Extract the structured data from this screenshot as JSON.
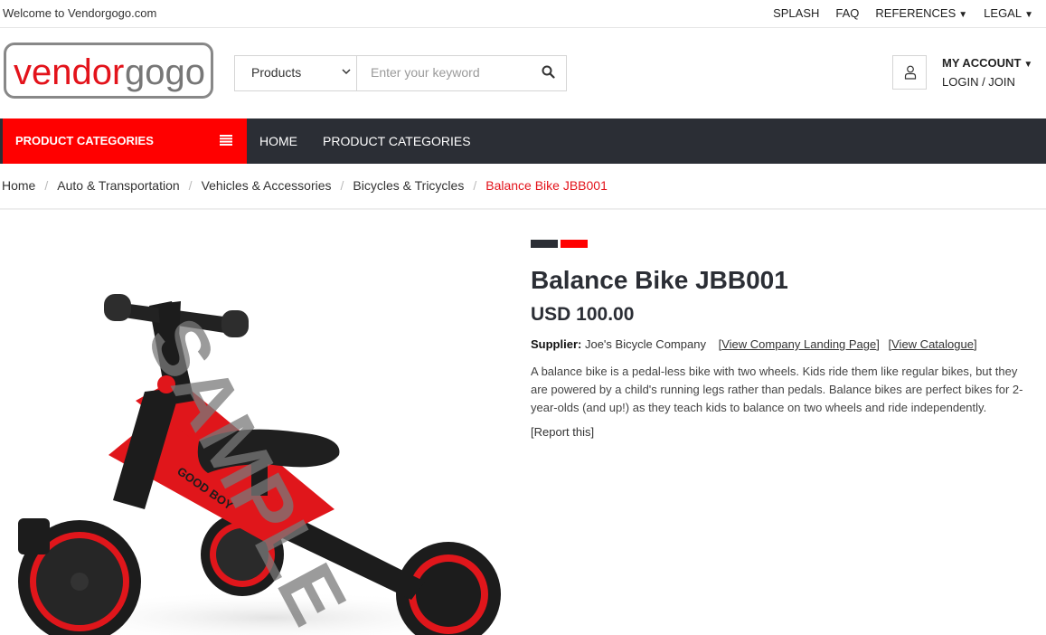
{
  "topbar": {
    "welcome": "Welcome to Vendorgogo.com",
    "links": [
      "SPLASH",
      "FAQ",
      "REFERENCES",
      "LEGAL"
    ]
  },
  "logo": {
    "part1": "vendor",
    "part2": "gogo"
  },
  "search": {
    "category": "Products",
    "placeholder": "Enter your keyword",
    "value": ""
  },
  "account": {
    "title": "MY ACCOUNT",
    "login": "LOGIN / JOIN"
  },
  "nav": {
    "categories_label": "PRODUCT CATEGORIES",
    "links": [
      "HOME",
      "PRODUCT CATEGORIES"
    ]
  },
  "breadcrumb": [
    "Home",
    "Auto & Transportation",
    "Vehicles & Accessories",
    "Bicycles & Tricycles",
    "Balance Bike JBB001"
  ],
  "product": {
    "image_watermark": "SAMPLE",
    "image_print": "GOOD BOY",
    "title": "Balance Bike JBB001",
    "price": "USD 100.00",
    "supplier_label": "Supplier:",
    "supplier_name": "Joe's Bicycle Company",
    "link_landing": "View Company Landing Page",
    "link_catalogue": "View Catalogue",
    "description": "A balance bike is a pedal-less bike with two wheels. Kids ride them like regular bikes, but they are powered by a child's running legs rather than pedals. Balance bikes are perfect bikes for 2-year-olds (and up!) as they teach kids to balance on two wheels and ride independently.",
    "report": "[Report this]"
  },
  "colors": {
    "accent": "#ff0000",
    "dark": "#2b2e35",
    "breadcrumb_active": "#e3131b"
  }
}
